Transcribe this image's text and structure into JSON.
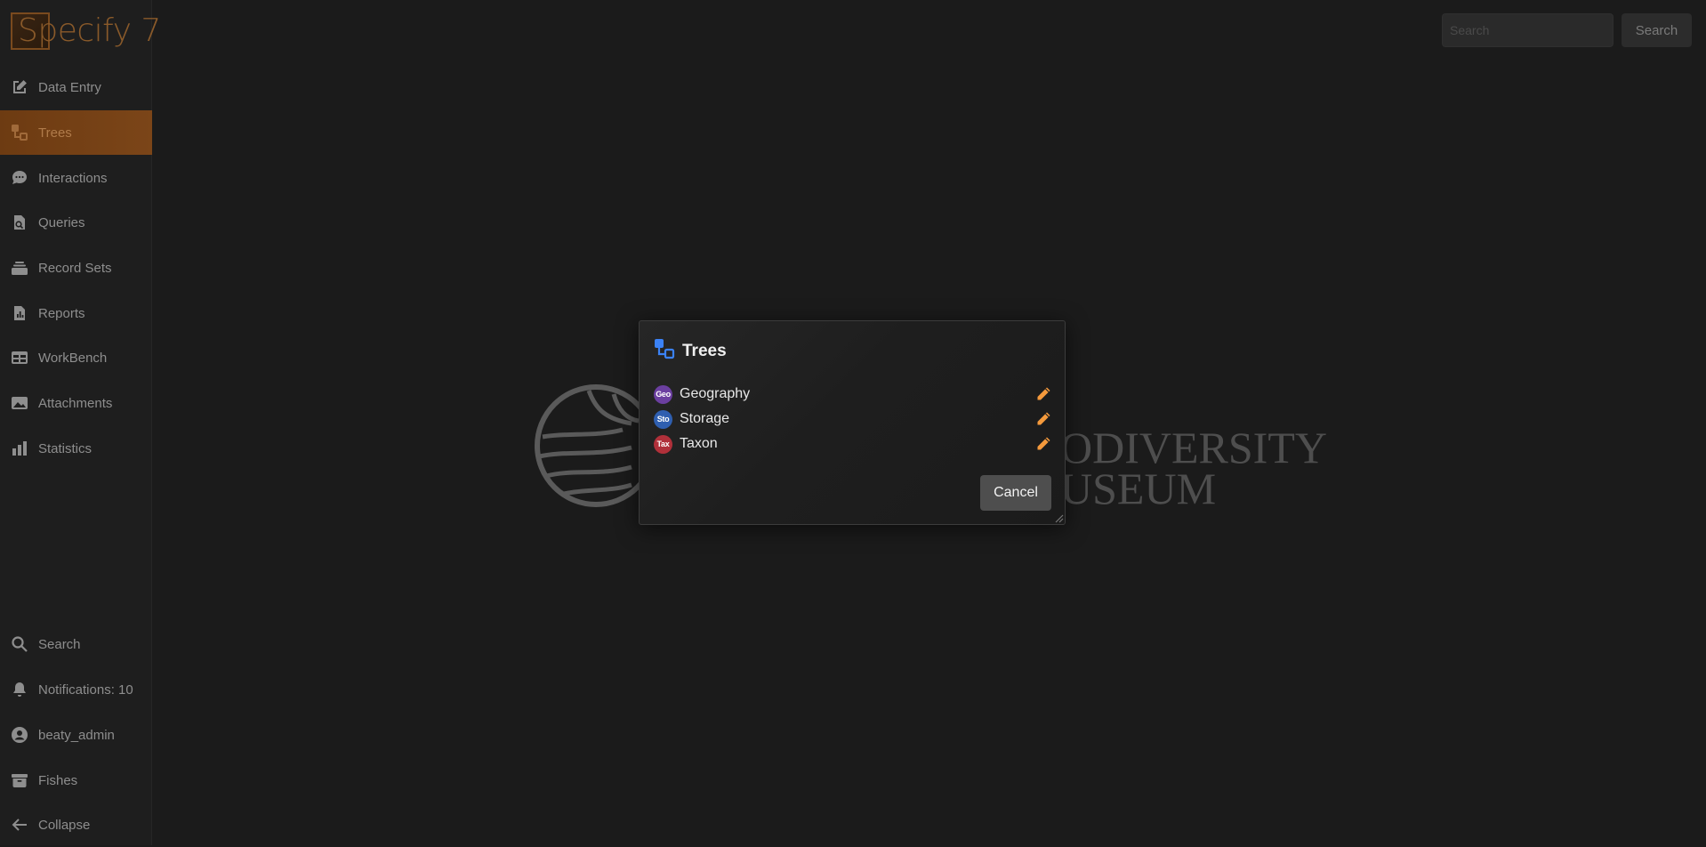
{
  "app": {
    "logo_text": "Specify 7",
    "brand_color": "#7b4518"
  },
  "sidebar": {
    "items": [
      {
        "label": "Data Entry",
        "icon": "pencil-square-icon",
        "active": false
      },
      {
        "label": "Trees",
        "icon": "tree-icon",
        "active": true
      },
      {
        "label": "Interactions",
        "icon": "chat-bubble-icon",
        "active": false
      },
      {
        "label": "Queries",
        "icon": "document-search-icon",
        "active": false
      },
      {
        "label": "Record Sets",
        "icon": "collection-icon",
        "active": false
      },
      {
        "label": "Reports",
        "icon": "document-report-icon",
        "active": false
      },
      {
        "label": "WorkBench",
        "icon": "table-icon",
        "active": false
      },
      {
        "label": "Attachments",
        "icon": "photograph-icon",
        "active": false
      },
      {
        "label": "Statistics",
        "icon": "chart-bar-icon",
        "active": false
      }
    ],
    "bottom_items": [
      {
        "label": "Search",
        "icon": "search-icon"
      },
      {
        "label": "Notifications: 10",
        "icon": "bell-icon"
      },
      {
        "label": "beaty_admin",
        "icon": "user-circle-icon"
      },
      {
        "label": "Fishes",
        "icon": "archive-icon"
      },
      {
        "label": "Collapse",
        "icon": "arrow-left-icon"
      }
    ]
  },
  "header": {
    "search_placeholder": "Search",
    "search_button": "Search"
  },
  "background_logo": {
    "line1": "ODIVERSITY",
    "line2": "USEUM"
  },
  "dialog": {
    "title": "Trees",
    "trees": [
      {
        "name": "Geography",
        "badge": "Geo",
        "badge_color": "#6b3fa0"
      },
      {
        "name": "Storage",
        "badge": "Sto",
        "badge_color": "#2f5fb0"
      },
      {
        "name": "Taxon",
        "badge": "Tax",
        "badge_color": "#b0303a"
      }
    ],
    "edit_icon_color": "#f59a3c",
    "cancel_label": "Cancel"
  }
}
